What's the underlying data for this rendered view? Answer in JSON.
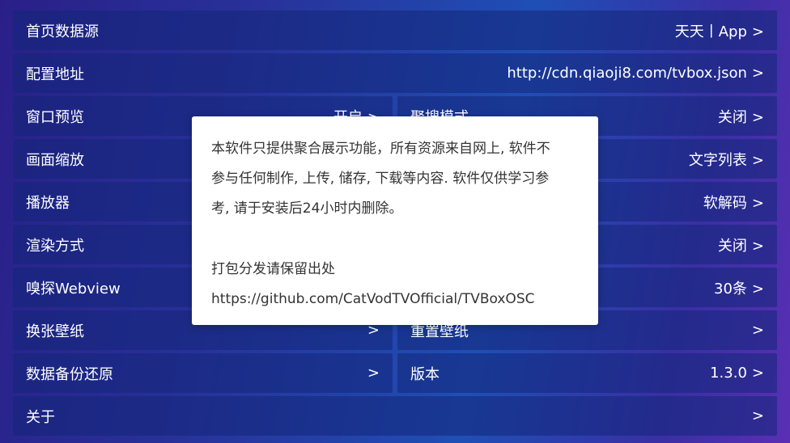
{
  "settings": {
    "homepage_source": {
      "label": "首页数据源",
      "value": "天天丨App"
    },
    "config_url": {
      "label": "配置地址",
      "value": "http://cdn.qiaoji8.com/tvbox.json"
    },
    "window_preview": {
      "label": "窗口预览",
      "value": "开启"
    },
    "search_mode": {
      "label": "聚搜模式",
      "value": "关闭"
    },
    "scale": {
      "label": "画面缩放",
      "value": "文字列表"
    },
    "player": {
      "label": "播放器",
      "value": "软解码"
    },
    "render": {
      "label": "渲染方式",
      "value": "关闭"
    },
    "sniff": {
      "label": "嗅探Webview",
      "value": "30条"
    },
    "wallpaper_change": {
      "label": "换张壁纸"
    },
    "wallpaper_reset": {
      "label": "重置壁纸"
    },
    "backup": {
      "label": "数据备份还原"
    },
    "version": {
      "label": "版本",
      "value": "1.3.0"
    },
    "about": {
      "label": "关于"
    }
  },
  "chevron": ">",
  "dialog": {
    "line1": "本软件只提供聚合展示功能，所有资源来自网上, 软件不",
    "line2": "参与任何制作, 上传, 储存, 下载等内容. 软件仅供学习参",
    "line3": "考, 请于安装后24小时内删除。",
    "line4": "打包分发请保留出处",
    "line5": "https://github.com/CatVodTVOfficial/TVBoxOSC"
  }
}
